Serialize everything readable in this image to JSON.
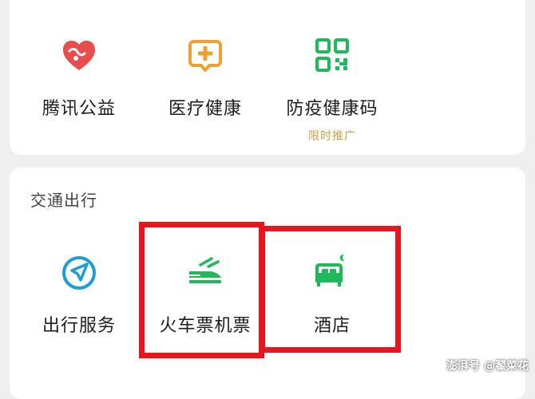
{
  "top_services": [
    {
      "label": "腾讯公益",
      "icon": "heart-icon",
      "color": "#e84c4c"
    },
    {
      "label": "医疗健康",
      "icon": "medical-plus-icon",
      "color": "#f0a030"
    },
    {
      "label": "防疫健康码",
      "icon": "qr-code-icon",
      "color": "#1fb85a",
      "sub": "限时推广",
      "sub_color": "#c9a24a"
    }
  ],
  "travel_section": {
    "title": "交通出行",
    "items": [
      {
        "label": "出行服务",
        "icon": "navigation-arrow-icon",
        "color": "#1f9bd6"
      },
      {
        "label": "火车票机票",
        "icon": "train-plane-icon",
        "color": "#1fb85a"
      },
      {
        "label": "酒店",
        "icon": "hotel-bed-icon",
        "color": "#1fb85a"
      }
    ]
  },
  "highlight_color": "#e8141e",
  "watermark": "澎湃号 @翟菜花"
}
